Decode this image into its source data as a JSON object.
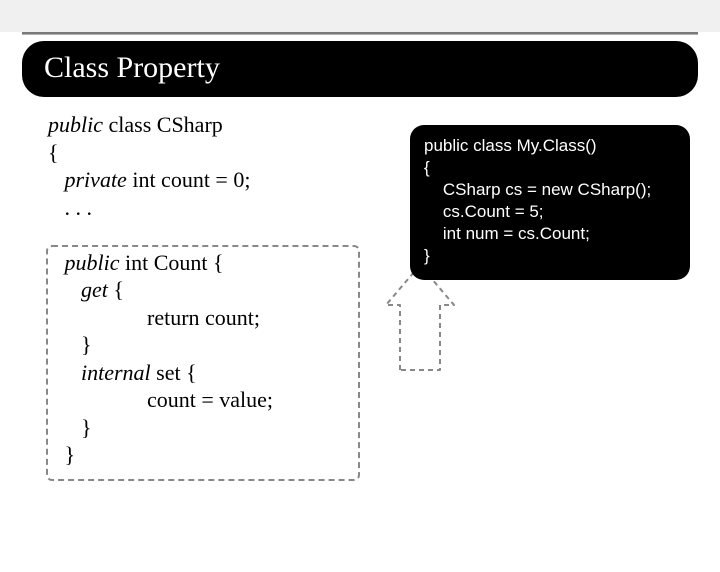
{
  "title": "Class Property",
  "left": {
    "l1a": "public",
    "l1b": " class CSharp",
    "l2": "{",
    "l3a": "   private",
    "l3b": " int count = 0;",
    "l4": "   . . .",
    "l5": "",
    "l6a": "   public",
    "l6b": " int Count {",
    "l7a": "      get",
    "l7b": " {",
    "l8": "                  return count;",
    "l9": "      }",
    "l10a": "      internal",
    "l10b": " set {",
    "l11": "                  count = value;",
    "l12": "      }",
    "l13": "   }"
  },
  "right": {
    "l1": "public class My.Class()",
    "l2": "{",
    "l3": "    CSharp cs = new CSharp();",
    "l4": "    cs.Count = 5;",
    "l5": "    int num = cs.Count;",
    "l6": "}"
  }
}
